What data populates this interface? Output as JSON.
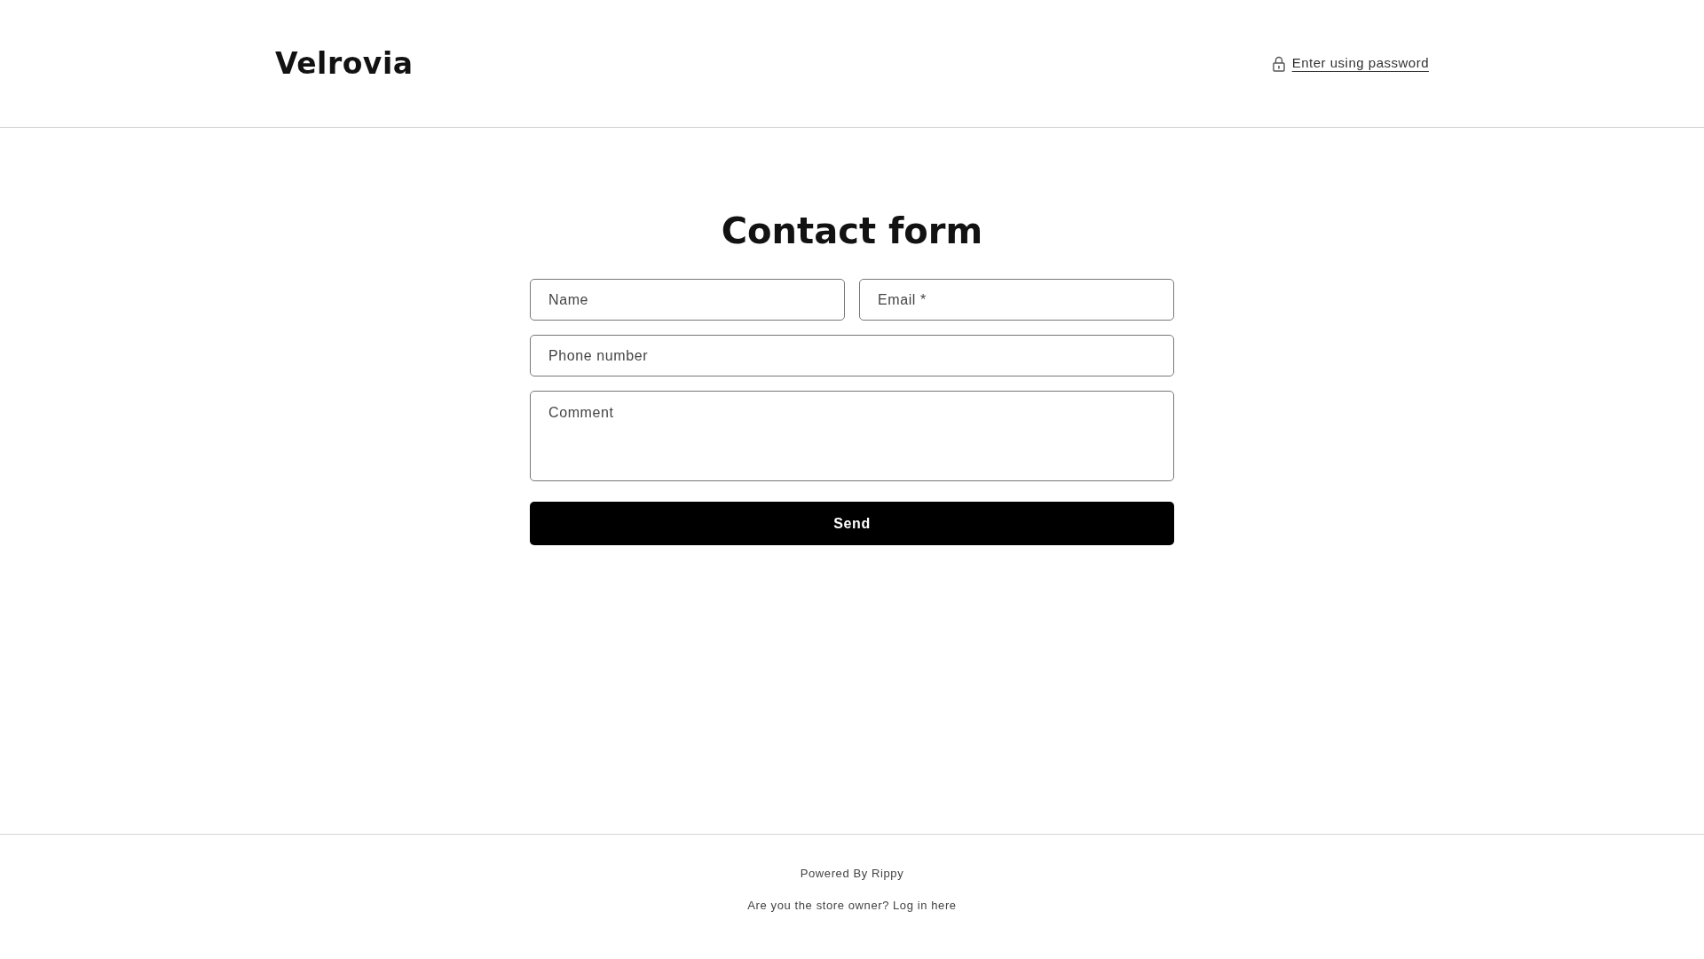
{
  "header": {
    "logo": "Velrovia",
    "password_link": "Enter using password"
  },
  "form": {
    "title": "Contact form",
    "fields": [
      {
        "kind": "input",
        "placeholder": "Name"
      },
      {
        "kind": "input",
        "placeholder": "Email *"
      },
      {
        "kind": "input",
        "placeholder": "Phone number"
      },
      {
        "kind": "textarea",
        "placeholder": "Comment"
      }
    ],
    "submit": "Send"
  },
  "footer": {
    "powered_by": "Powered By Rippy",
    "owner_prompt": "Are you the store owner?",
    "login_link": "Log in here"
  }
}
